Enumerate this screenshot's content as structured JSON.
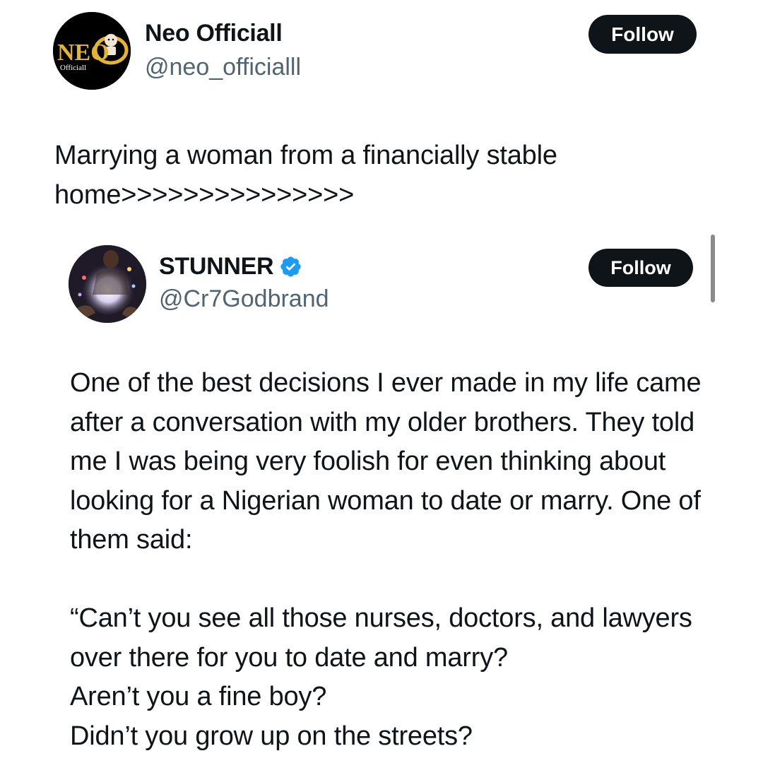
{
  "main_tweet": {
    "author_name": "Neo Officiall",
    "author_handle": "@neo_officialll",
    "avatar_logo_text": "NEO",
    "avatar_logo_subtext": "Officiall",
    "follow_label": "Follow",
    "text": "Marrying a woman from a financially stable home>>>>>>>>>>>>>>>"
  },
  "quoted_tweet": {
    "author_name": "STUNNER",
    "author_handle": "@Cr7Godbrand",
    "verified_icon": "verified-badge-icon",
    "follow_label": "Follow",
    "text": "One of the best decisions I ever made in my life came after a conversation with my older brothers. They told me I was being very foolish for even thinking about looking for a Nigerian woman to date or marry. One of them said:\n\n“Can’t you see all those nurses, doctors, and lawyers over there for you to date and marry?\nAren’t you a fine boy?\nDidn’t you grow up on the streets?"
  },
  "colors": {
    "text_primary": "#0f1419",
    "text_secondary": "#536471",
    "button_bg": "#0f1419",
    "verified_blue": "#1d9bf0",
    "logo_gold": "#e3b23c"
  }
}
